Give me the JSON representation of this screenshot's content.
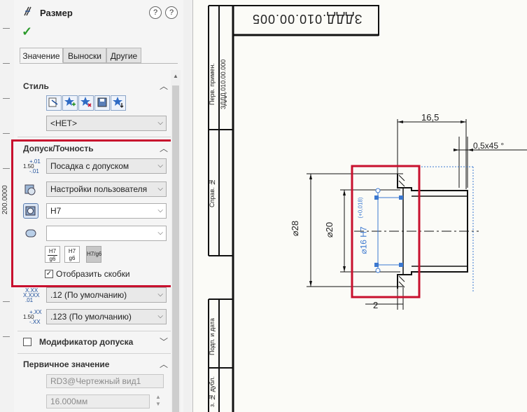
{
  "ruler": {
    "value": "200.0000"
  },
  "panel": {
    "title": "Размер",
    "help1": "?",
    "help2": "?",
    "ok_glyph": "✓",
    "tabs": [
      "Значение",
      "Выноски",
      "Другие"
    ],
    "style": {
      "title": "Стиль",
      "combo": "<НЕТ>"
    },
    "tolerance": {
      "title": "Допуск/Точность",
      "type": "Посадка с допуском",
      "classification": "Настройки пользователя",
      "hole_fit": "H7",
      "shaft_fit": "",
      "show_brackets": "Отобразить скобки",
      "show_brackets_checked": true,
      "precision1": ".12 (По умолчанию)",
      "precision2": ".123 (По умолчанию)",
      "icon1_a": "+.01",
      "icon1_b": "1.50",
      "icon1_c": "-.01",
      "icon2_a": "X.XX",
      "icon2_b": "X.XXX",
      "icon2_c": ".01",
      "icon3_a": "+.XX",
      "icon3_b": "1.50",
      "icon3_c": "-.XX",
      "fmt1_top": "H7",
      "fmt1_bottom": "g6",
      "fmt2_top": "H7",
      "fmt2_bottom": "g6",
      "fmt3": "H7/g6"
    },
    "modifier": {
      "title": "Модификатор допуска"
    },
    "primary": {
      "title": "Первичное значение",
      "ref": "RD3@Чертежный вид1",
      "value": "16.000мм"
    }
  },
  "drawing": {
    "title_block_text": "ЗДДД.010.00.005",
    "side_perv": "Перв. примен.",
    "side_code": "ЗДДД.010.00.000",
    "side_sprav": "Справ. №",
    "side_podp": "Подп. и дата",
    "side_dubl": "з. № дубл.",
    "dim_16_5": "16,5",
    "dim_chamfer": "0,5x45 °",
    "dim_28": "⌀28",
    "dim_20": "⌀20",
    "dim_16h7": "⌀16 H7",
    "dim_tol": "(+0,018)",
    "dim_2": "2"
  }
}
